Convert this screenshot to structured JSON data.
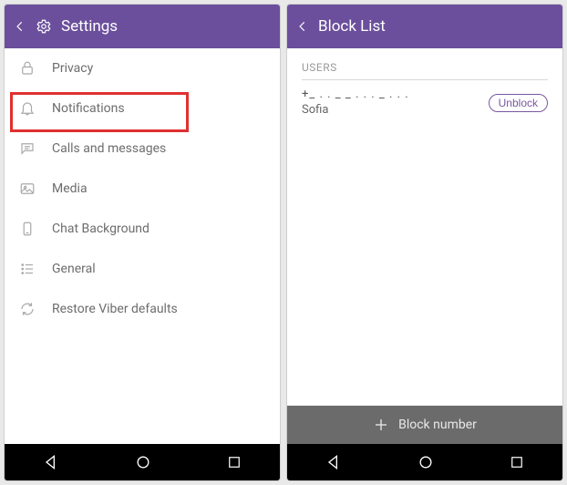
{
  "settings": {
    "title": "Settings",
    "items": [
      {
        "label": "Privacy",
        "icon": "lock-icon"
      },
      {
        "label": "Notifications",
        "icon": "bell-icon"
      },
      {
        "label": "Calls and messages",
        "icon": "chat-icon"
      },
      {
        "label": "Media",
        "icon": "image-icon"
      },
      {
        "label": "Chat Background",
        "icon": "phone-square-icon"
      },
      {
        "label": "General",
        "icon": "list-icon"
      },
      {
        "label": "Restore Viber defaults",
        "icon": "refresh-icon"
      }
    ]
  },
  "blocklist": {
    "title": "Block List",
    "section_header": "USERS",
    "user": {
      "number": "+_ . . _ _ . . . _ . . .",
      "name": "Sofia",
      "unblock_label": "Unblock"
    },
    "block_number_label": "Block number"
  }
}
